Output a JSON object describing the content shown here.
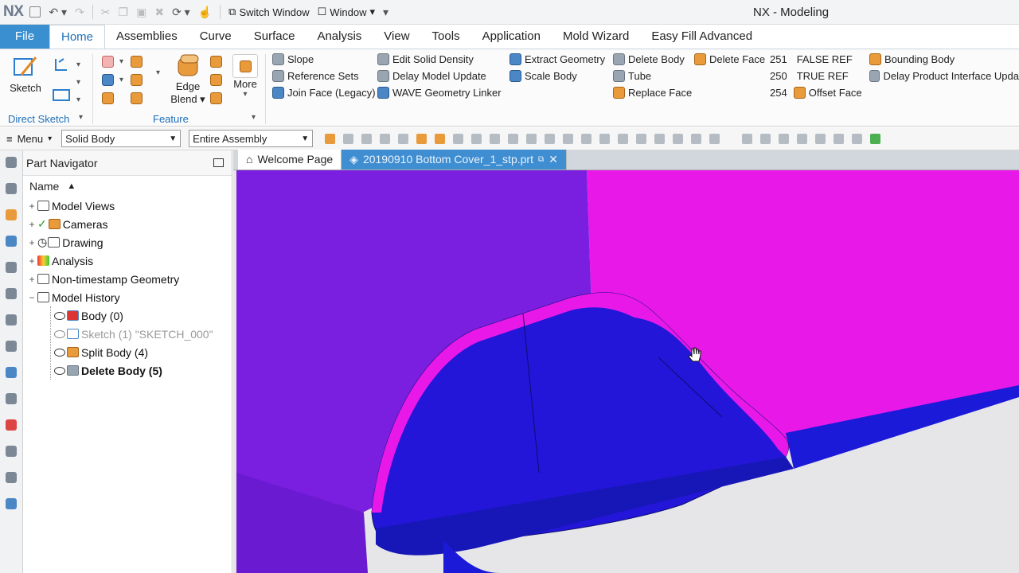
{
  "app": {
    "logo": "NX",
    "window_title": "NX - Modeling"
  },
  "quick_access": {
    "switch_window": "Switch Window",
    "window": "Window"
  },
  "menu_tabs": [
    "File",
    "Home",
    "Assemblies",
    "Curve",
    "Surface",
    "Analysis",
    "View",
    "Tools",
    "Application",
    "Mold Wizard",
    "Easy Fill Advanced"
  ],
  "ribbon": {
    "sketch": "Sketch",
    "direct_sketch": "Direct Sketch",
    "edge_blend_1": "Edge",
    "edge_blend_2": "Blend",
    "more": "More",
    "feature": "Feature",
    "col1": [
      "Slope",
      "Reference Sets",
      "Join Face (Legacy)"
    ],
    "col2": [
      "Edit Solid Density",
      "Delay Model Update",
      "WAVE Geometry Linker"
    ],
    "col3": [
      "Extract Geometry",
      "Scale Body"
    ],
    "col4": [
      "Delete Body",
      "Tube",
      "Replace Face"
    ],
    "delete_face": "Delete Face",
    "refs": [
      {
        "num": "251",
        "label": "FALSE REF"
      },
      {
        "num": "250",
        "label": "TRUE REF"
      },
      {
        "num": "254",
        "label": "Offset Face"
      }
    ],
    "col6": [
      "Bounding Body",
      "Delay Product Interface Upda"
    ]
  },
  "toolbar": {
    "menu": "Menu",
    "filter": "Solid Body",
    "scope": "Entire Assembly"
  },
  "navigator": {
    "title": "Part Navigator",
    "column": "Name",
    "nodes": [
      {
        "label": "Model Views",
        "pm": "+"
      },
      {
        "label": "Cameras",
        "pm": "+"
      },
      {
        "label": "Drawing",
        "pm": "+"
      },
      {
        "label": "Analysis",
        "pm": "+"
      },
      {
        "label": "Non-timestamp Geometry",
        "pm": "+"
      },
      {
        "label": "Model History",
        "pm": "−"
      }
    ],
    "history": [
      {
        "label": "Body (0)"
      },
      {
        "label": "Sketch (1) \"SKETCH_000\""
      },
      {
        "label": "Split Body (4)"
      },
      {
        "label": "Delete Body (5)"
      }
    ]
  },
  "doc_tabs": {
    "welcome": "Welcome Page",
    "part": "20190910 Bottom Cover_1_stp.prt"
  },
  "colors": {
    "accent": "#3a8fd0",
    "viewport_purple": "#7a1fe0",
    "body_magenta": "#e819e8",
    "body_blue": "#1a1ad8"
  }
}
